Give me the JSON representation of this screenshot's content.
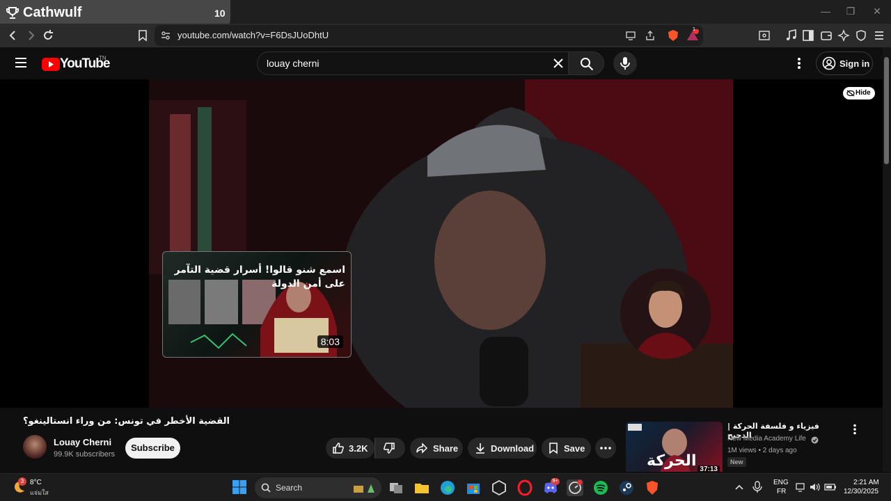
{
  "browser": {
    "tab_title": "Cathwulf",
    "tab_count": "10",
    "url": "youtube.com/watch?v=F6DsJUoDhtU",
    "shields_badge": "1"
  },
  "youtube": {
    "logo_text": "YouTube",
    "logo_region": "TN",
    "search_value": "louay cherni",
    "sign_in_label": "Sign in",
    "hide_label": "Hide",
    "end_card": {
      "title": "اسمع شنو قالوا! أسرار قضية التآمر على أمن الدولة",
      "duration": "8:03"
    },
    "video": {
      "title": "القضية الأخطر في تونس: من وراء انستالينغو؟",
      "channel": "Louay Cherni",
      "subscribers": "99.9K subscribers",
      "subscribe_label": "Subscribe",
      "likes": "3.2K",
      "share_label": "Share",
      "download_label": "Download",
      "save_label": "Save"
    },
    "recommended": {
      "title": "فيزياء و فلسفة الحركة | الدحيح",
      "channel": "New Media Academy Life",
      "meta": "1M views • 2 days ago",
      "badge": "New",
      "duration": "37:13",
      "thumb_text": "الحركة"
    }
  },
  "taskbar": {
    "weather_temp": "8°C",
    "weather_cond": "แจ่มใส",
    "weather_badge": "3",
    "search_label": "Search",
    "lang_line1": "ENG",
    "lang_line2": "FR",
    "time": "2:21 AM",
    "date": "12/30/2025",
    "discord_badge": "9+"
  },
  "colors": {
    "youtube_red": "#ff0000",
    "background": "#0f0f0f",
    "pill": "#272727",
    "brave_orange": "#fb542b"
  }
}
